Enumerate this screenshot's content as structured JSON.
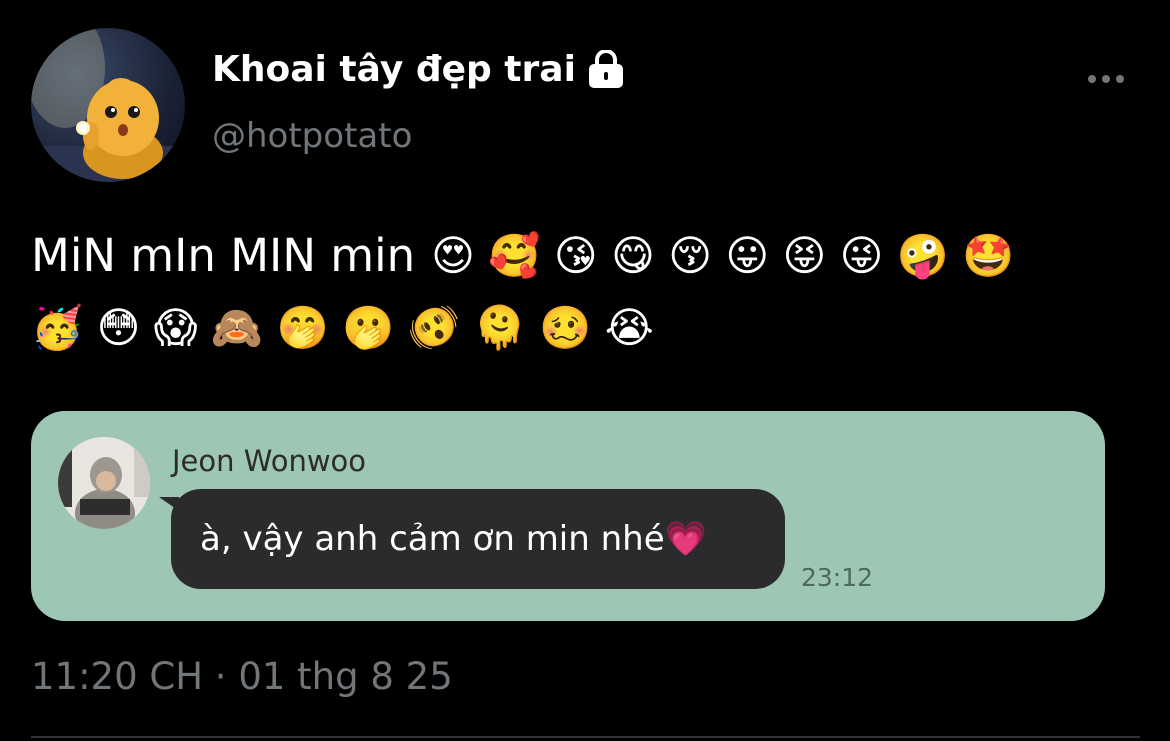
{
  "tweet": {
    "author": {
      "display_name": "Khoai tây đẹp trai",
      "handle": "@hotpotato",
      "avatar_icon": "potato-character-with-flashlight",
      "protected_icon": "lock-icon"
    },
    "more_icon": "more-dots-icon",
    "text": {
      "line1_words": "MiN mIn MIN min",
      "line1_emojis": "😍 🥰 😘 😋 😚 😛 😝 😜 🤪 🤩",
      "line2_emojis": "🥳 😳 😱 🙈 🤭 🫢 🫨 🫠 🥴 😭"
    },
    "media": {
      "background_color": "#9ec6b4",
      "contact_name": "Jeon Wonwoo",
      "message": "à, vậy anh cảm ơn min nhé💗",
      "time": "23:12"
    },
    "meta": "11:20 CH · 01 thg 8 25"
  },
  "colors": {
    "background": "#000000",
    "secondary_text": "#71767b",
    "bubble": "#2b2b2d"
  }
}
